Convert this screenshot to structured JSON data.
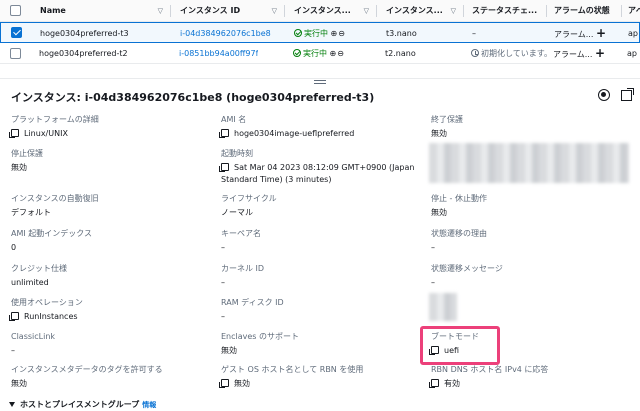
{
  "table": {
    "headers": {
      "name": "Name",
      "instance_id": "インスタンス ID",
      "state": "インスタンス...",
      "type": "インスタンス...",
      "status_check": "ステータスチェ...",
      "alarm": "アラームの状態",
      "az": "アベ"
    },
    "rows": [
      {
        "name": "hoge0304preferred-t3",
        "id": "i-04d384962076c1be8",
        "state": "実行中",
        "type": "t3.nano",
        "status": "–",
        "alarm": "アラーム...",
        "az": "ap",
        "selected": true
      },
      {
        "name": "hoge0304preferred-t2",
        "id": "i-0851bb94a00ff97f",
        "state": "実行中",
        "type": "t2.nano",
        "status": "初期化しています。",
        "alarm": "アラーム...",
        "az": "ap",
        "selected": false
      }
    ]
  },
  "details": {
    "title": "インスタンス: i-04d384962076c1be8 (hoge0304preferred-t3)",
    "fields": {
      "platform_label": "プラットフォームの詳細",
      "platform_value": "Linux/UNIX",
      "ami_name_label": "AMI 名",
      "ami_name_value": "hoge0304image-ueflpreferred",
      "termination_label": "終了保護",
      "termination_value": "無効",
      "stop_protection_label": "停止保護",
      "stop_protection_value": "無効",
      "launch_time_label": "起動時刻",
      "launch_time_value": "Sat Mar 04 2023 08:12:09 GMT+0900 (Japan Standard Time) (3 minutes)",
      "auto_recovery_label": "インスタンスの自動復旧",
      "auto_recovery_value": "デフォルト",
      "lifecycle_label": "ライフサイクル",
      "lifecycle_value": "ノーマル",
      "stop_hibernate_label": "停止 - 休止動作",
      "stop_hibernate_value": "無効",
      "ami_launch_index_label": "AMI 起動インデックス",
      "ami_launch_index_value": "0",
      "key_pair_label": "キーペア名",
      "key_pair_value": "–",
      "state_reason_label": "状態遷移の理由",
      "state_reason_value": "–",
      "credit_label": "クレジット仕様",
      "credit_value": "unlimited",
      "kernel_label": "カーネル ID",
      "kernel_value": "–",
      "state_message_label": "状態遷移メッセージ",
      "state_message_value": "–",
      "usage_label": "使用オペレーション",
      "usage_value": "RunInstances",
      "ramdisk_label": "RAM ディスク ID",
      "ramdisk_value": "–",
      "classiclink_label": "ClassicLink",
      "classiclink_value": "–",
      "enclaves_label": "Enclaves のサポート",
      "enclaves_value": "無効",
      "boot_mode_label": "ブートモード",
      "boot_mode_value": "uefi",
      "metadata_tags_label": "インスタンスメタデータのタグを許可する",
      "metadata_tags_value": "無効",
      "guest_os_label": "ゲスト OS ホスト名として RBN を使用",
      "guest_os_value": "無効",
      "rbn_dns_label": "RBN DNS ホスト名 IPv4 に応答",
      "rbn_dns_value": "有効"
    },
    "section": {
      "label": "ホストとプレイスメントグループ",
      "info": "情報"
    }
  },
  "colors": {
    "accent": "#0972d3",
    "running": "#037f0c",
    "highlight": "#ec407a"
  }
}
